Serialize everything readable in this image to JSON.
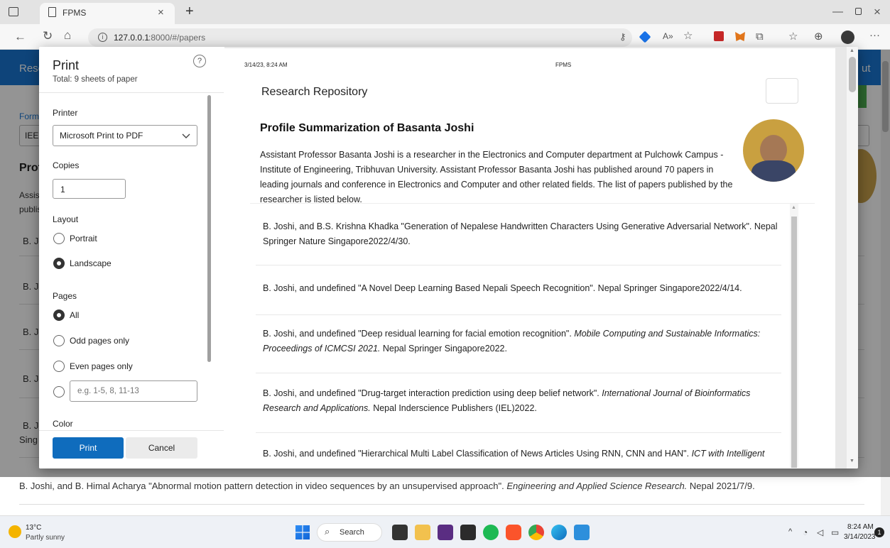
{
  "browser": {
    "tab_title": "FPMS",
    "url_host": "127.0.0.1",
    "url_rest": ":8000/#/papers"
  },
  "background_page": {
    "header_left": "Rese",
    "header_right": "ut",
    "format_label": "Form",
    "format_value": "IEEE",
    "profile_heading": "Prof",
    "desc_lines": [
      "Assist",
      "publis"
    ],
    "rows": [
      "B. Jo",
      "B. Jo",
      "B. Jo",
      "B. Jo",
      "B. Jo"
    ],
    "row5_line2": "Sing",
    "bottom_citation": "B. Joshi, and B. Himal Acharya \"Abnormal motion pattern detection in video sequences by an unsupervised approach\".",
    "bottom_citation_journal": "Engineering and Applied Science Research.",
    "bottom_citation_tail": "Nepal 2021/7/9."
  },
  "print_dialog": {
    "title": "Print",
    "total": "Total: 9 sheets of paper",
    "help": "?",
    "printer_label": "Printer",
    "printer_value": "Microsoft Print to PDF",
    "copies_label": "Copies",
    "copies_value": "1",
    "layout_label": "Layout",
    "layout_options": [
      "Portrait",
      "Landscape"
    ],
    "layout_selected": "Landscape",
    "pages_label": "Pages",
    "pages_options": [
      "All",
      "Odd pages only",
      "Even pages only"
    ],
    "pages_selected": "All",
    "pages_custom_placeholder": "e.g. 1-5, 8, 11-13",
    "color_label": "Color",
    "print_button": "Print",
    "cancel_button": "Cancel"
  },
  "preview": {
    "header_date": "3/14/23, 8:24 AM",
    "header_title": "FPMS",
    "site_title": "Research Repository",
    "profile_title": "Profile Summarization of Basanta Joshi",
    "profile_desc": "Assistant Professor Basanta Joshi is a researcher in the Electronics and Computer department at Pulchowk Campus - Institute of Engineering, Tribhuvan University. Assistant Professor Basanta Joshi has published around 70 papers in leading journals and conference in Electronics and Computer and other related fields. The list of papers published by the researcher is listed below.",
    "papers": [
      {
        "text": "B. Joshi, and B.S. Krishna Khadka \"Generation of Nepalese Handwritten Characters Using Generative Adversarial Network\". Nepal Springer Nature Singapore2022/4/30.",
        "journal": "",
        "tail": ""
      },
      {
        "text": "B. Joshi, and undefined \"A Novel Deep Learning Based Nepali Speech Recognition\". Nepal Springer Singapore2022/4/14.",
        "journal": "",
        "tail": ""
      },
      {
        "text": "B. Joshi, and undefined \"Deep residual learning for facial emotion recognition\". ",
        "journal": "Mobile Computing and Sustainable Informatics: Proceedings of ICMCSI 2021.",
        "tail": " Nepal Springer Singapore2022."
      },
      {
        "text": "B. Joshi, and undefined \"Drug-target interaction prediction using deep belief network\". ",
        "journal": "International Journal of Bioinformatics Research and Applications.",
        "tail": " Nepal Inderscience Publishers (IEL)2022."
      },
      {
        "text": "B. Joshi, and undefined \"Hierarchical Multi Label Classification of News Articles Using RNN, CNN and HAN\". ",
        "journal": "ICT with Intelligent",
        "tail": ""
      }
    ]
  },
  "taskbar": {
    "weather_temp": "13°C",
    "weather_desc": "Partly sunny",
    "search": "Search",
    "time": "8:24 AM",
    "date": "3/14/2023",
    "notification_count": "1"
  },
  "colors": {
    "accent_blue": "#1976d2",
    "green_button": "#4caf50",
    "print_button_blue": "#0f6cbd"
  }
}
